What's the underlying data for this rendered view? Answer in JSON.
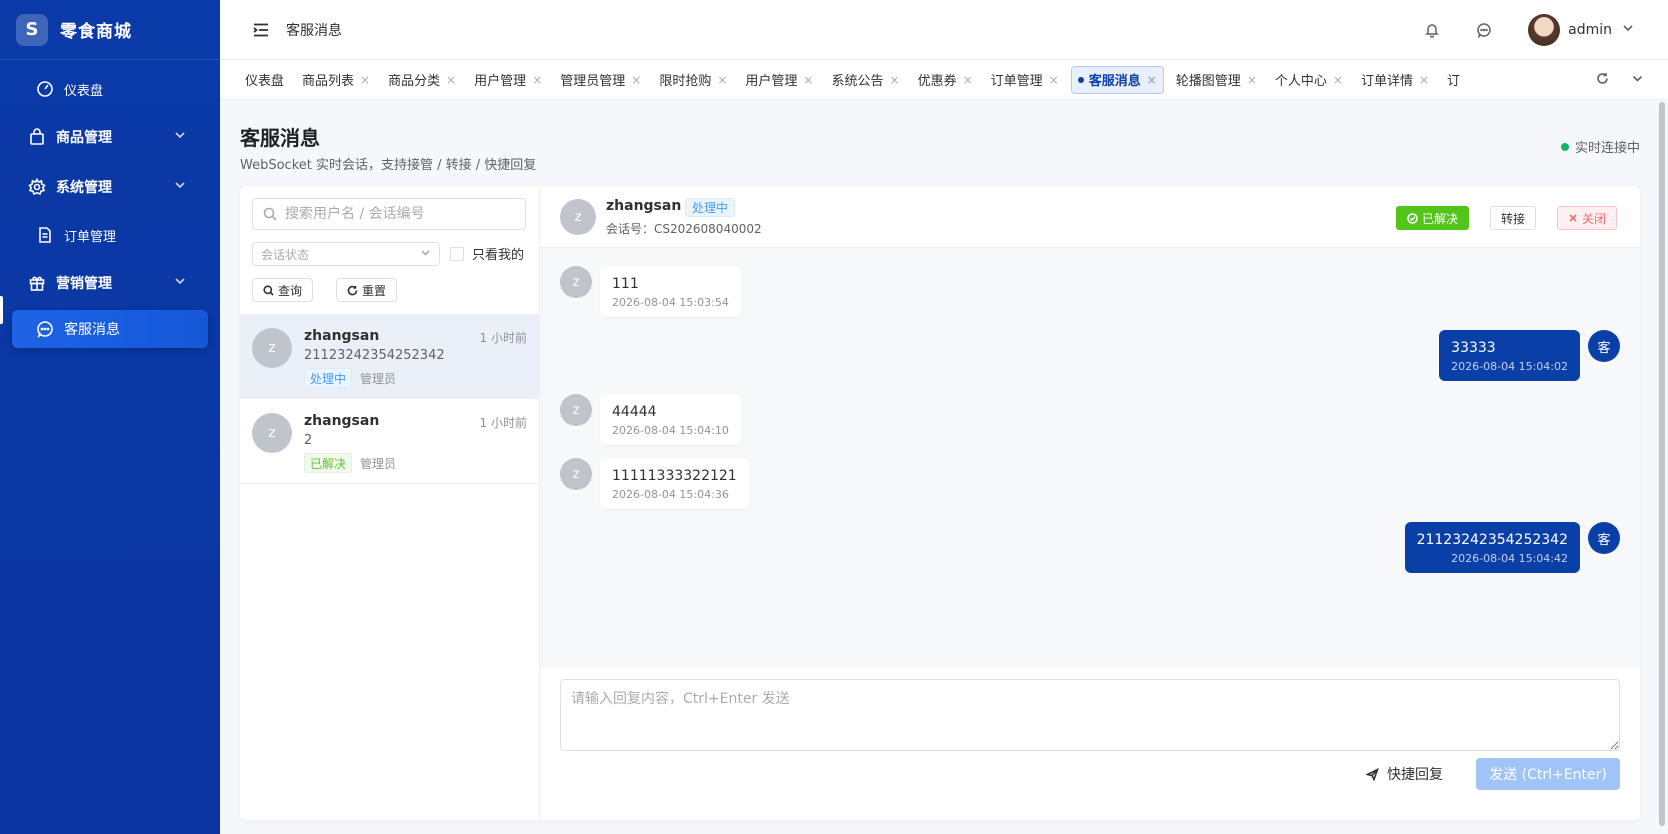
{
  "brand": {
    "logo": "S",
    "name": "零食商城"
  },
  "sidebar": {
    "items": [
      {
        "label": "仪表盘",
        "icon": "dashboard-icon"
      },
      {
        "label": "商品管理",
        "icon": "bag-icon"
      },
      {
        "label": "系统管理",
        "icon": "gear-icon"
      },
      {
        "label": "订单管理",
        "icon": "document-icon"
      },
      {
        "label": "营销管理",
        "icon": "gift-icon"
      },
      {
        "label": "客服消息",
        "icon": "chat-icon"
      }
    ]
  },
  "header": {
    "title": "客服消息",
    "user": "admin"
  },
  "tabs": [
    "仪表盘",
    "商品列表",
    "商品分类",
    "用户管理",
    "管理员管理",
    "限时抢购",
    "用户管理",
    "系统公告",
    "优惠券",
    "订单管理",
    "客服消息",
    "轮播图管理",
    "个人中心",
    "订单详情",
    "订"
  ],
  "page": {
    "title": "客服消息",
    "subtitle": "WebSocket 实时会话，支持接管 / 转接 / 快捷回复",
    "live_status": "实时连接中"
  },
  "filters": {
    "search_placeholder": "搜索用户名 / 会话编号",
    "status_placeholder": "会话状态",
    "only_mine": "只看我的",
    "query": "查询",
    "reset": "重置"
  },
  "conversations": [
    {
      "avatar": "z",
      "name": "zhangsan",
      "time": "1 小时前",
      "last": "21123242354252342",
      "status": "处理中",
      "role": "管理员"
    },
    {
      "avatar": "z",
      "name": "zhangsan",
      "time": "1 小时前",
      "last": "2",
      "status": "已解决",
      "role": "管理员"
    }
  ],
  "chat": {
    "avatar": "z",
    "name": "zhangsan",
    "status": "处理中",
    "session": "会话号：CS202608040002",
    "resolved_btn": "已解决",
    "transfer_btn": "转接",
    "close_btn": "关闭"
  },
  "messages": [
    {
      "from": "user",
      "avatar": "z",
      "text": "111",
      "time": "2026-08-04 15:03:54"
    },
    {
      "from": "agent",
      "avatar": "客",
      "text": "33333",
      "time": "2026-08-04 15:04:02"
    },
    {
      "from": "user",
      "avatar": "z",
      "text": "44444",
      "time": "2026-08-04 15:04:10"
    },
    {
      "from": "user",
      "avatar": "z",
      "text": "11111333322121",
      "time": "2026-08-04 15:04:36"
    },
    {
      "from": "agent",
      "avatar": "客",
      "text": "21123242354252342",
      "time": "2026-08-04 15:04:42"
    }
  ],
  "composer": {
    "placeholder": "请输入回复内容，Ctrl+Enter 发送",
    "quick_reply": "快捷回复",
    "send": "发送 (Ctrl+Enter)"
  }
}
